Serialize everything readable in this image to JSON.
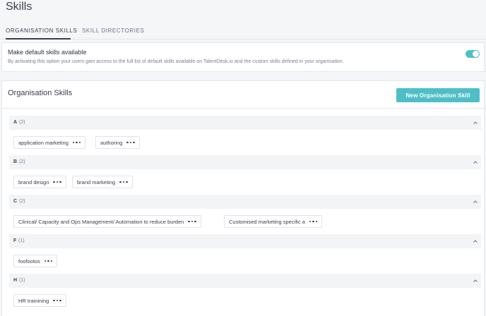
{
  "page": {
    "title": "Skills"
  },
  "tabs": [
    {
      "label": "ORGANISATION SKILLS",
      "active": true
    },
    {
      "label": "SKILL DIRECTORIES",
      "active": false
    }
  ],
  "default_skills": {
    "title": "Make default skills available",
    "description": "By activating this option your users gain access to the full list of default skills available on TalentDesk.io and the custom skills defined in your organisation.",
    "enabled": true
  },
  "org_skills": {
    "title": "Organisation Skills",
    "new_button_label": "New Organisation Skill",
    "groups": [
      {
        "letter": "A",
        "count": "(2)",
        "skills": [
          "application marketing",
          "authoring"
        ]
      },
      {
        "letter": "B",
        "count": "(2)",
        "skills": [
          "brand design",
          "brand marketing"
        ]
      },
      {
        "letter": "C",
        "count": "(2)",
        "skills": [
          "Clinical/ Capacity and Ops Management/ Automation to reduce burden",
          "Customised marketing specific a"
        ]
      },
      {
        "letter": "F",
        "count": "(1)",
        "skills": [
          "foofootos"
        ]
      },
      {
        "letter": "H",
        "count": "(1)",
        "skills": [
          "HR trainining"
        ]
      }
    ]
  },
  "colors": {
    "accent": "#4fbfc7",
    "text": "#3a3f4b",
    "muted": "#7a8090",
    "group_bg": "#f3f4f6"
  }
}
